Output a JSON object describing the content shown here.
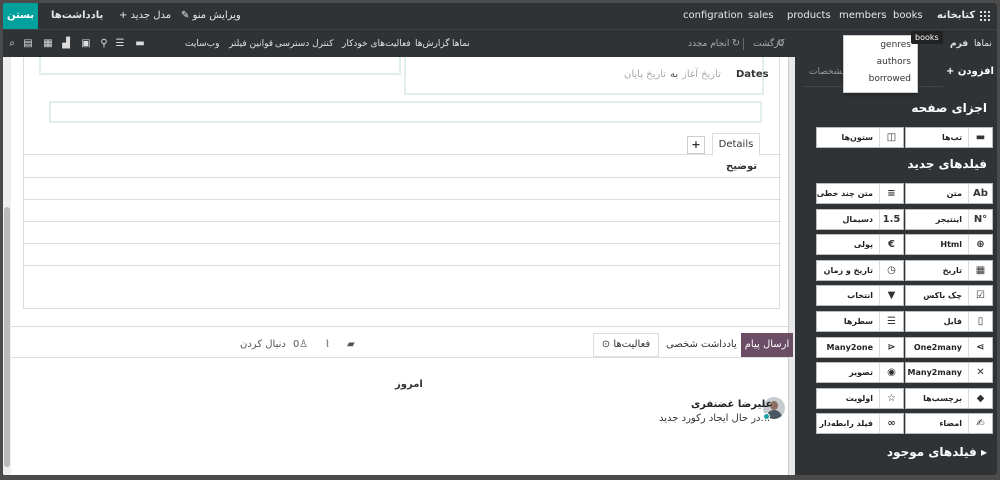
{
  "topbar": {
    "close_label": "بستن",
    "notes_label": "یادداشت‌ها",
    "new_model_label": "+ مدل جدید",
    "edit_menu_label": "✎ ویرایش منو",
    "menu_items": [
      "configration",
      "sales",
      "products",
      "members",
      "books"
    ],
    "app_name": "کتابخانه"
  },
  "subbar": {
    "views": "نماها",
    "reports": "گزارش‌ها",
    "automations": "فعالیت‌های خودکار",
    "access": "کنترل دسترسی",
    "filters": "قوانین فیلتر",
    "website": "وب‌سایت",
    "redo": "انجام مجدد",
    "undo": "بازگشت",
    "form": "فرم",
    "views_right": "نماها"
  },
  "dropdown": {
    "tooltip": "books",
    "items": [
      "genres",
      "authors",
      "borrowed"
    ]
  },
  "form": {
    "dates_label": "Dates",
    "date_start_placeholder": "تاریخ آغاز",
    "date_to": "به",
    "date_end_placeholder": "تاریخ پایان",
    "tab_details": "Details",
    "tab_add": "+",
    "description_label": "توضیح"
  },
  "chatter": {
    "send_message": "ارسال پیام",
    "log_note": "یادداشت شخصی",
    "activities": "⊙ فعالیت‌ها",
    "follow": "دنبال کردن",
    "followers_count": "0",
    "today": "امروز",
    "author": "علیرضا غضنفری",
    "message": "در حال ایجاد رکورد جدید..."
  },
  "panel": {
    "add_tab": "+ افزودن",
    "props_tab": "مشخصات",
    "components_heading": "اجزای صفحه",
    "components": [
      {
        "label": "تب‌ها",
        "icon": "tabs-icon"
      },
      {
        "label": "ستون‌ها",
        "icon": "columns-icon"
      }
    ],
    "new_fields_heading": "فیلدهای جدید",
    "fields": [
      {
        "label": "متن",
        "icon": "text-icon",
        "glyph": "Ab"
      },
      {
        "label": "متن چند خطی",
        "icon": "multiline-text-icon",
        "glyph": "≡"
      },
      {
        "label": "اینتیجر",
        "icon": "integer-icon",
        "glyph": "N°"
      },
      {
        "label": "دسیمال",
        "icon": "decimal-icon",
        "glyph": "1.5"
      },
      {
        "label": "Html",
        "icon": "globe-icon",
        "glyph": "⊕"
      },
      {
        "label": "پولی",
        "icon": "euro-icon",
        "glyph": "€"
      },
      {
        "label": "تاریخ",
        "icon": "calendar-icon",
        "glyph": "▦"
      },
      {
        "label": "تاریخ و زمان",
        "icon": "clock-icon",
        "glyph": "◷"
      },
      {
        "label": "چک باکس",
        "icon": "checkbox-icon",
        "glyph": "☑"
      },
      {
        "label": "انتخاب",
        "icon": "caret-down-icon",
        "glyph": "▼"
      },
      {
        "label": "فایل",
        "icon": "file-icon",
        "glyph": "▯"
      },
      {
        "label": "سطرها",
        "icon": "lines-icon",
        "glyph": "☰"
      },
      {
        "label": "One2many",
        "icon": "one2many-icon",
        "glyph": "⋖"
      },
      {
        "label": "Many2one",
        "icon": "many2one-icon",
        "glyph": "⋗"
      },
      {
        "label": "Many2many",
        "icon": "many2many-icon",
        "glyph": "✕"
      },
      {
        "label": "تصویر",
        "icon": "camera-icon",
        "glyph": "◉"
      },
      {
        "label": "برچسب‌ها",
        "icon": "tag-icon",
        "glyph": "◆"
      },
      {
        "label": "اولویت",
        "icon": "star-icon",
        "glyph": "☆"
      },
      {
        "label": "امضاء",
        "icon": "signature-icon",
        "glyph": "✍"
      },
      {
        "label": "فیلد رابطه‌دار",
        "icon": "link-icon",
        "glyph": "∞"
      }
    ],
    "existing_fields_heading": "فیلدهای موجود ▸"
  }
}
